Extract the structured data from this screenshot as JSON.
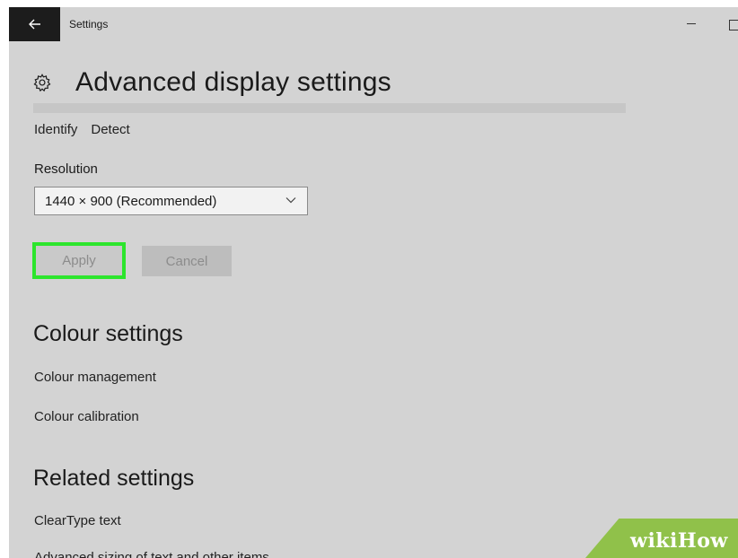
{
  "window": {
    "app_title": "Settings"
  },
  "header": {
    "title": "Advanced display settings"
  },
  "display": {
    "identify_label": "Identify",
    "detect_label": "Detect",
    "resolution_label": "Resolution",
    "resolution_value": "1440 × 900 (Recommended)",
    "apply_label": "Apply",
    "cancel_label": "Cancel"
  },
  "colour_settings": {
    "title": "Colour settings",
    "items": [
      "Colour management",
      "Colour calibration"
    ]
  },
  "related_settings": {
    "title": "Related settings",
    "items": [
      "ClearType text",
      "Advanced sizing of text and other items"
    ]
  },
  "watermark": {
    "part1": "wiki",
    "part2": "How"
  },
  "colors": {
    "window_bg": "#d3d3d3",
    "back_button_bg": "#1c1c1c",
    "highlight_border": "#2ce52c",
    "watermark_green": "#90c14a"
  },
  "icons": {
    "back": "back-arrow-icon",
    "header": "gear-icon",
    "dropdown": "chevron-down-icon"
  }
}
